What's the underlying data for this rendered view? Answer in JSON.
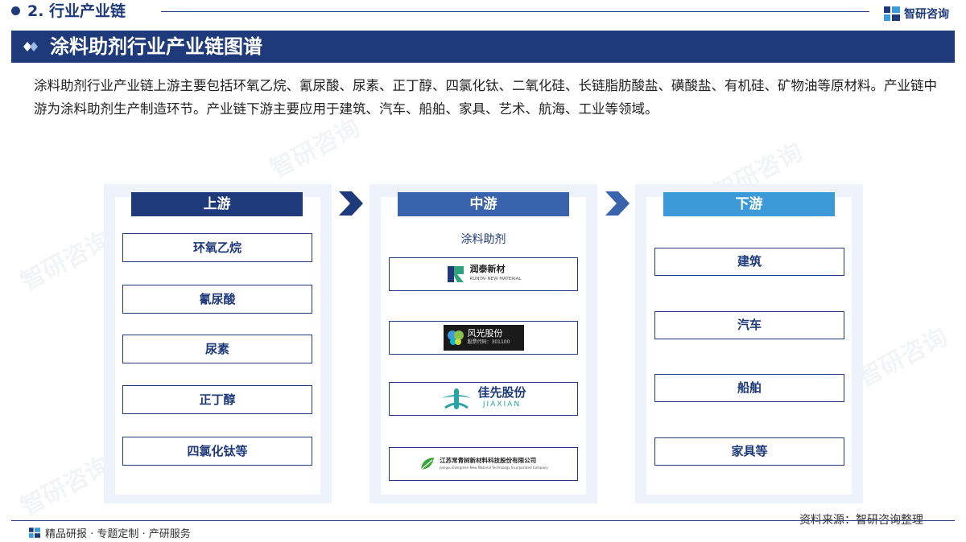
{
  "header": {
    "section_title": "2. 行业产业链",
    "brand": "智研咨询",
    "banner_title": "涂料助剂行业产业链图谱"
  },
  "description": "涂料助剂行业产业链上游主要包括环氧乙烷、氰尿酸、尿素、正丁醇、四氯化钛、二氧化硅、长链脂肪酸盐、磺酸盐、有机硅、矿物油等原材料。产业链中游为涂料助剂生产制造环节。产业链下游主要应用于建筑、汽车、船舶、家具、艺术、航海、工业等领域。",
  "upstream": {
    "header": "上游",
    "items": [
      "环氧乙烷",
      "氰尿酸",
      "尿素",
      "正丁醇",
      "四氯化钛等"
    ]
  },
  "midstream": {
    "header": "中游",
    "label": "涂料助剂",
    "companies": [
      {
        "name": "润泰新材",
        "sub": "RUNTAI NEW MATERIAL"
      },
      {
        "name": "风光股份",
        "sub": "股票代码：301100"
      },
      {
        "name": "佳先股份",
        "sub": "JIAXIAN"
      },
      {
        "name": "江苏常青树新材料科技股份有限公司",
        "sub": "Jiangsu Evergreen New Material Technology Incorporated Company"
      }
    ]
  },
  "downstream": {
    "header": "下游",
    "items": [
      "建筑",
      "汽车",
      "船舶",
      "家具等"
    ]
  },
  "footer": {
    "tagline": "精品研报 · 专题定制 · 产研服务",
    "source": "资料来源：智研咨询整理"
  },
  "colors": {
    "navy": "#1e3a7b",
    "mid_blue": "#3a63ae",
    "light_blue": "#3c9ad8",
    "panel_bg": "#eef2fb"
  },
  "watermark": "智研咨询"
}
